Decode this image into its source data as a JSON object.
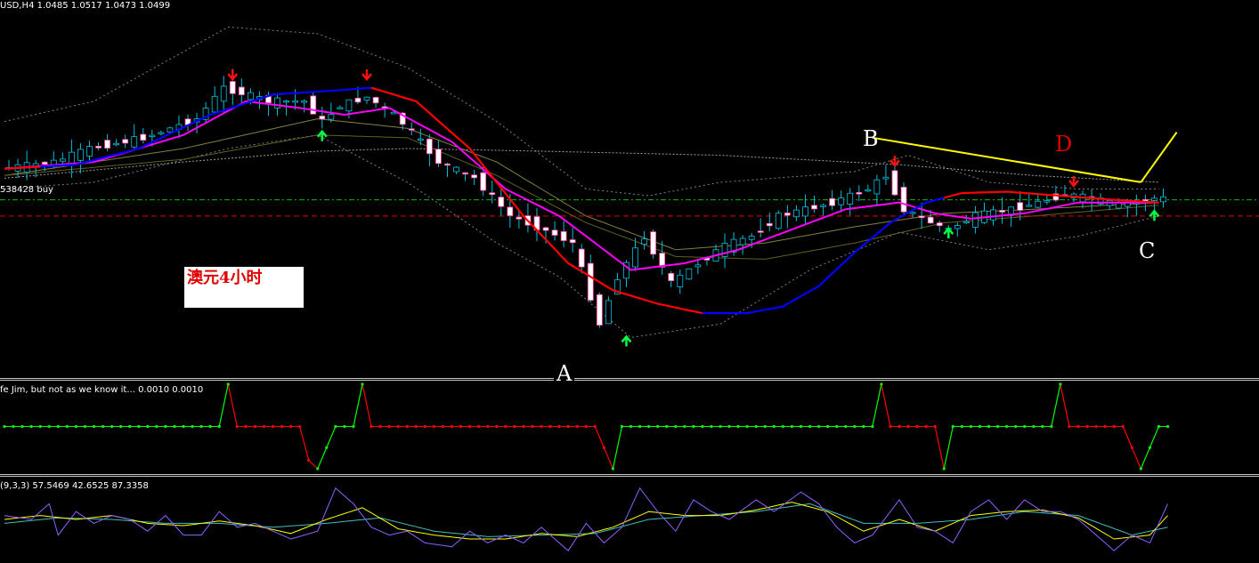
{
  "chart_title": "USD,H4  1.0485 1.0517 1.0473 1.0499",
  "order_label": "538428 buy",
  "annotation_box": "澳元4小时",
  "points": {
    "A": "A",
    "B": "B",
    "C": "C",
    "D": "D"
  },
  "indicator1_label": "fe Jim, but not as we know it...  0.0010 0.0010",
  "indicator2_label": "(9,3,3) 57.5469 42.6525 87.3358",
  "colors": {
    "background": "#000000",
    "bull_candle": "#000000",
    "bear_candle": "#ffffff",
    "wick": "#00c0e0",
    "ma_fast": "#ff00ff",
    "ma_trend_up": "#0000ff",
    "ma_trend_down": "#ff0000",
    "order_line": "#00c000",
    "stop_line": "#e00000",
    "trendline": "#ffff00",
    "arrow_up": "#00ff40",
    "arrow_down": "#ff1010",
    "osc_up": "#00ff00",
    "osc_down": "#ff0000",
    "stoch_main": "#9060ff",
    "stoch_signal": "#ffff00",
    "stoch_aux": "#40c0c0"
  },
  "chart_data": {
    "type": "candlestick",
    "symbol": "USD",
    "timeframe": "H4",
    "header_values": {
      "open": 1.0485,
      "high": 1.0517,
      "low": 1.0473,
      "close": 1.0499
    },
    "ylim": [
      1.03,
      1.058
    ],
    "candle_count": 130,
    "price_path": [
      [
        0,
        1.0455
      ],
      [
        6,
        1.046
      ],
      [
        10,
        1.047
      ],
      [
        16,
        1.0478
      ],
      [
        22,
        1.0492
      ],
      [
        25,
        1.0515
      ],
      [
        30,
        1.0505
      ],
      [
        34,
        1.0505
      ],
      [
        36,
        1.049
      ],
      [
        38,
        1.0502
      ],
      [
        41,
        1.0508
      ],
      [
        44,
        1.0495
      ],
      [
        46,
        1.0482
      ],
      [
        49,
        1.046
      ],
      [
        53,
        1.0448
      ],
      [
        57,
        1.042
      ],
      [
        60,
        1.0412
      ],
      [
        64,
        1.04
      ],
      [
        67,
        1.034
      ],
      [
        69,
        1.0375
      ],
      [
        72,
        1.0405
      ],
      [
        75,
        1.037
      ],
      [
        78,
        1.0385
      ],
      [
        81,
        1.0398
      ],
      [
        84,
        1.0405
      ],
      [
        87,
        1.042
      ],
      [
        90,
        1.0425
      ],
      [
        93,
        1.043
      ],
      [
        97,
        1.044
      ],
      [
        99,
        1.045
      ],
      [
        101,
        1.0425
      ],
      [
        103,
        1.0418
      ],
      [
        106,
        1.041
      ],
      [
        109,
        1.042
      ],
      [
        113,
        1.0425
      ],
      [
        116,
        1.043
      ],
      [
        119,
        1.0436
      ],
      [
        122,
        1.0433
      ],
      [
        125,
        1.0428
      ],
      [
        129,
        1.0433
      ]
    ],
    "upper_band_path": [
      [
        0,
        1.049
      ],
      [
        10,
        1.0505
      ],
      [
        25,
        1.056
      ],
      [
        35,
        1.0555
      ],
      [
        45,
        1.053
      ],
      [
        55,
        1.049
      ],
      [
        65,
        1.044
      ],
      [
        72,
        1.0435
      ],
      [
        80,
        1.0445
      ],
      [
        90,
        1.045
      ],
      [
        95,
        1.0453
      ],
      [
        101,
        1.0465
      ],
      [
        110,
        1.0445
      ],
      [
        120,
        1.044
      ],
      [
        129,
        1.044
      ]
    ],
    "lower_band_path": [
      [
        0,
        1.044
      ],
      [
        10,
        1.0445
      ],
      [
        25,
        1.047
      ],
      [
        35,
        1.048
      ],
      [
        45,
        1.0445
      ],
      [
        55,
        1.04
      ],
      [
        62,
        1.0375
      ],
      [
        70,
        1.033
      ],
      [
        80,
        1.034
      ],
      [
        90,
        1.038
      ],
      [
        100,
        1.0408
      ],
      [
        110,
        1.0395
      ],
      [
        120,
        1.0405
      ],
      [
        129,
        1.042
      ]
    ],
    "ma_fast_path": [
      [
        0,
        1.0455
      ],
      [
        10,
        1.046
      ],
      [
        20,
        1.048
      ],
      [
        27,
        1.0505
      ],
      [
        33,
        1.05
      ],
      [
        38,
        1.0495
      ],
      [
        43,
        1.05
      ],
      [
        50,
        1.0475
      ],
      [
        56,
        1.044
      ],
      [
        62,
        1.042
      ],
      [
        67,
        1.0395
      ],
      [
        70,
        1.038
      ],
      [
        76,
        1.0385
      ],
      [
        82,
        1.0395
      ],
      [
        88,
        1.041
      ],
      [
        94,
        1.0425
      ],
      [
        100,
        1.043
      ],
      [
        104,
        1.0422
      ],
      [
        108,
        1.0418
      ],
      [
        114,
        1.0422
      ],
      [
        120,
        1.043
      ],
      [
        129,
        1.043
      ]
    ],
    "ma_trend_path": [
      [
        0,
        1.0455
      ],
      [
        8,
        1.0458
      ],
      [
        15,
        1.047
      ],
      [
        23,
        1.0495
      ],
      [
        30,
        1.051
      ],
      [
        37,
        1.0513
      ],
      [
        41,
        1.0515
      ],
      [
        46,
        1.0505
      ],
      [
        52,
        1.047
      ],
      [
        58,
        1.042
      ],
      [
        63,
        1.0385
      ],
      [
        68,
        1.0365
      ],
      [
        73,
        1.0355
      ],
      [
        78,
        1.0348
      ],
      [
        83,
        1.0348
      ],
      [
        87,
        1.0353
      ],
      [
        91,
        1.0368
      ],
      [
        95,
        1.0393
      ],
      [
        99,
        1.0415
      ],
      [
        103,
        1.043
      ],
      [
        107,
        1.0437
      ],
      [
        112,
        1.0438
      ],
      [
        118,
        1.0435
      ],
      [
        124,
        1.0432
      ],
      [
        129,
        1.043
      ]
    ],
    "ma_trend_color_runs": [
      [
        0,
        4,
        "red"
      ],
      [
        4,
        10,
        "blue"
      ],
      [
        10,
        41,
        "blue"
      ],
      [
        41,
        78,
        "red"
      ],
      [
        78,
        105,
        "blue"
      ],
      [
        105,
        129,
        "red"
      ]
    ],
    "ma_slow_path": [
      [
        0,
        1.045
      ],
      [
        20,
        1.047
      ],
      [
        35,
        1.0492
      ],
      [
        45,
        1.0485
      ],
      [
        55,
        1.046
      ],
      [
        65,
        1.042
      ],
      [
        75,
        1.0395
      ],
      [
        85,
        1.04
      ],
      [
        95,
        1.0412
      ],
      [
        105,
        1.0422
      ],
      [
        115,
        1.0425
      ],
      [
        129,
        1.043
      ]
    ],
    "ma_slow2_path": [
      [
        0,
        1.045
      ],
      [
        20,
        1.0462
      ],
      [
        35,
        1.048
      ],
      [
        45,
        1.0478
      ],
      [
        55,
        1.045
      ],
      [
        65,
        1.0415
      ],
      [
        75,
        1.039
      ],
      [
        85,
        1.0388
      ],
      [
        95,
        1.04
      ],
      [
        105,
        1.0415
      ],
      [
        115,
        1.042
      ],
      [
        129,
        1.0428
      ]
    ],
    "ma_long_path": [
      [
        0,
        1.0448
      ],
      [
        20,
        1.046
      ],
      [
        35,
        1.0468
      ],
      [
        45,
        1.047
      ],
      [
        60,
        1.0468
      ],
      [
        80,
        1.0465
      ],
      [
        100,
        1.0458
      ],
      [
        115,
        1.045
      ],
      [
        129,
        1.0445
      ]
    ],
    "order_price": 1.0432,
    "stop_price": 1.042,
    "arrows_down": [
      [
        25,
        1.0522
      ],
      [
        40,
        1.0522
      ],
      [
        99,
        1.0458
      ],
      [
        119,
        1.0443
      ]
    ],
    "arrows_up": [
      [
        35,
        1.0482
      ],
      [
        69,
        1.033
      ],
      [
        105,
        1.041
      ],
      [
        128,
        1.0423
      ]
    ],
    "trendline_BD": [
      [
        97,
        1.0478
      ],
      [
        127,
        1.0445
      ]
    ],
    "trendline_C_up": [
      [
        127,
        1.0445
      ],
      [
        131,
        1.0482
      ]
    ],
    "point_positions": {
      "A": [
        63,
        1.0318
      ],
      "B": [
        98,
        1.0462
      ],
      "C": [
        129,
        1.041
      ],
      "D": [
        119,
        1.0458
      ]
    },
    "indicator1": {
      "ylim": [
        0,
        1
      ],
      "levels": [
        [
          0,
          0.5
        ],
        [
          23,
          0.5
        ],
        [
          24,
          0.5
        ],
        [
          25,
          1.0
        ],
        [
          26,
          0.5
        ],
        [
          33,
          0.5
        ],
        [
          34,
          0.1
        ],
        [
          35,
          0.0
        ],
        [
          37,
          0.5
        ],
        [
          39,
          0.5
        ],
        [
          40,
          1.0
        ],
        [
          41,
          0.5
        ],
        [
          66,
          0.5
        ],
        [
          68,
          0.0
        ],
        [
          69,
          0.5
        ],
        [
          97,
          0.5
        ],
        [
          98,
          1.0
        ],
        [
          99,
          0.5
        ],
        [
          104,
          0.5
        ],
        [
          105,
          0.0
        ],
        [
          106,
          0.5
        ],
        [
          117,
          0.5
        ],
        [
          118,
          1.0
        ],
        [
          119,
          0.5
        ],
        [
          125,
          0.5
        ],
        [
          127,
          0.0
        ],
        [
          129,
          0.5
        ],
        [
          130,
          0.5
        ]
      ]
    },
    "stochastic": {
      "ylim": [
        0,
        100
      ],
      "main": [
        [
          0,
          55
        ],
        [
          3,
          50
        ],
        [
          5,
          70
        ],
        [
          6,
          30
        ],
        [
          8,
          60
        ],
        [
          10,
          45
        ],
        [
          12,
          55
        ],
        [
          14,
          50
        ],
        [
          16,
          35
        ],
        [
          18,
          55
        ],
        [
          20,
          30
        ],
        [
          22,
          30
        ],
        [
          24,
          60
        ],
        [
          26,
          40
        ],
        [
          28,
          45
        ],
        [
          30,
          35
        ],
        [
          32,
          25
        ],
        [
          35,
          35
        ],
        [
          37,
          90
        ],
        [
          39,
          70
        ],
        [
          41,
          40
        ],
        [
          43,
          30
        ],
        [
          45,
          35
        ],
        [
          47,
          20
        ],
        [
          50,
          15
        ],
        [
          52,
          35
        ],
        [
          54,
          20
        ],
        [
          56,
          30
        ],
        [
          58,
          20
        ],
        [
          60,
          40
        ],
        [
          63,
          10
        ],
        [
          65,
          45
        ],
        [
          67,
          20
        ],
        [
          69,
          40
        ],
        [
          71,
          90
        ],
        [
          73,
          60
        ],
        [
          75,
          35
        ],
        [
          77,
          75
        ],
        [
          79,
          60
        ],
        [
          81,
          50
        ],
        [
          84,
          75
        ],
        [
          86,
          60
        ],
        [
          89,
          85
        ],
        [
          91,
          70
        ],
        [
          93,
          40
        ],
        [
          95,
          20
        ],
        [
          97,
          30
        ],
        [
          100,
          75
        ],
        [
          102,
          40
        ],
        [
          104,
          35
        ],
        [
          106,
          20
        ],
        [
          108,
          60
        ],
        [
          110,
          75
        ],
        [
          112,
          50
        ],
        [
          114,
          75
        ],
        [
          116,
          60
        ],
        [
          118,
          60
        ],
        [
          120,
          50
        ],
        [
          122,
          30
        ],
        [
          124,
          10
        ],
        [
          126,
          30
        ],
        [
          128,
          20
        ],
        [
          130,
          70
        ]
      ],
      "signal": [
        [
          0,
          50
        ],
        [
          4,
          55
        ],
        [
          8,
          50
        ],
        [
          12,
          55
        ],
        [
          16,
          45
        ],
        [
          20,
          42
        ],
        [
          24,
          48
        ],
        [
          28,
          42
        ],
        [
          32,
          32
        ],
        [
          36,
          50
        ],
        [
          40,
          65
        ],
        [
          44,
          38
        ],
        [
          48,
          30
        ],
        [
          52,
          25
        ],
        [
          56,
          25
        ],
        [
          60,
          32
        ],
        [
          64,
          28
        ],
        [
          68,
          40
        ],
        [
          72,
          60
        ],
        [
          76,
          55
        ],
        [
          80,
          55
        ],
        [
          84,
          62
        ],
        [
          88,
          72
        ],
        [
          92,
          60
        ],
        [
          96,
          35
        ],
        [
          100,
          50
        ],
        [
          104,
          35
        ],
        [
          108,
          55
        ],
        [
          112,
          60
        ],
        [
          116,
          62
        ],
        [
          120,
          52
        ],
        [
          124,
          25
        ],
        [
          128,
          30
        ],
        [
          130,
          55
        ]
      ],
      "aux": [
        [
          0,
          45
        ],
        [
          6,
          52
        ],
        [
          12,
          50
        ],
        [
          18,
          45
        ],
        [
          24,
          45
        ],
        [
          30,
          40
        ],
        [
          36,
          45
        ],
        [
          42,
          52
        ],
        [
          48,
          35
        ],
        [
          54,
          28
        ],
        [
          60,
          30
        ],
        [
          66,
          32
        ],
        [
          72,
          50
        ],
        [
          78,
          55
        ],
        [
          84,
          60
        ],
        [
          90,
          70
        ],
        [
          96,
          45
        ],
        [
          102,
          45
        ],
        [
          108,
          50
        ],
        [
          114,
          60
        ],
        [
          120,
          55
        ],
        [
          126,
          30
        ],
        [
          130,
          40
        ]
      ]
    }
  }
}
